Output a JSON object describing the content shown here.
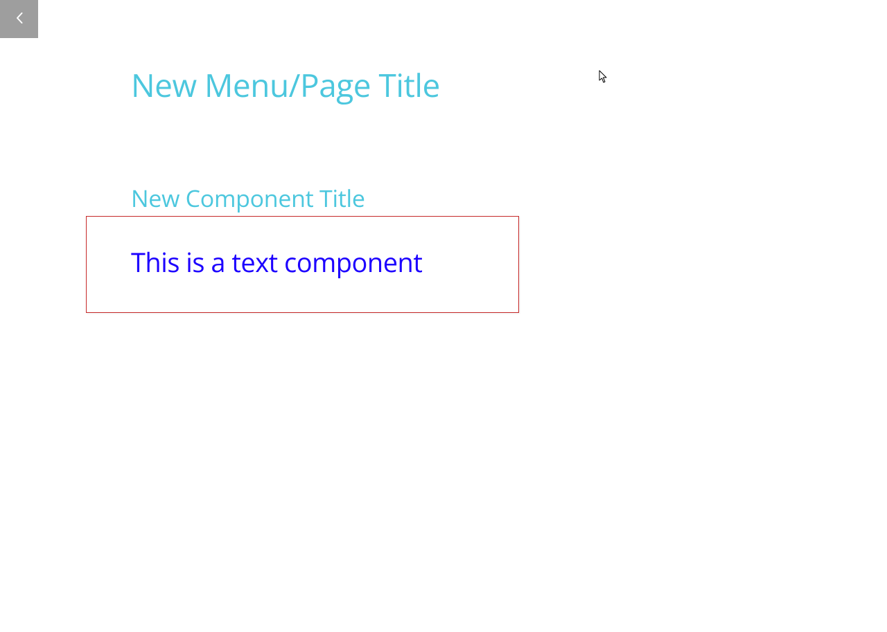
{
  "page": {
    "title": "New Menu/Page Title"
  },
  "component": {
    "title": "New Component Title",
    "text": "This is a text component"
  },
  "colors": {
    "accent": "#4cc7de",
    "textComponent": "#1c00ff",
    "selectionBorder": "#c62828",
    "collapseButton": "#9e9e9e"
  }
}
